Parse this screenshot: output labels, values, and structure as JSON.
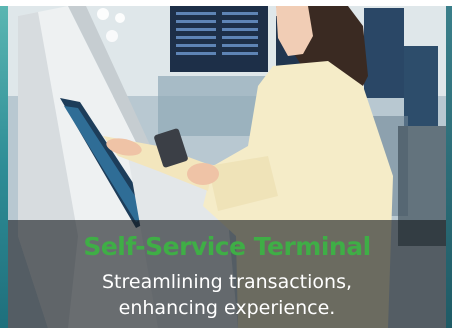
{
  "caption": {
    "title": "Self-Service Terminal",
    "subtitle_line1": "Streamlining transactions,",
    "subtitle_line2": "enhancing experience."
  },
  "colors": {
    "title_green": "#3fae46",
    "subtitle_white": "#ffffff",
    "band_overlay": "rgba(22, 28, 32, 0.62)"
  }
}
